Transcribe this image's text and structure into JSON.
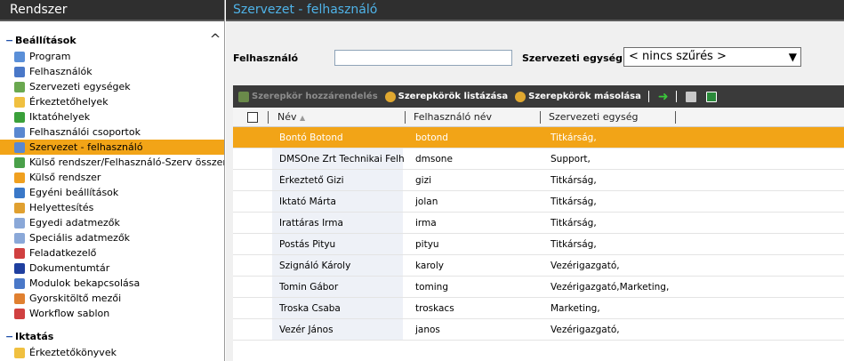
{
  "left_panel": {
    "title": "Rendszer",
    "sections": [
      {
        "label": "Beállítások",
        "items": [
          {
            "label": "Program",
            "icon": "gears-icon",
            "color": "#5a8fd8"
          },
          {
            "label": "Felhasználók",
            "icon": "user-icon",
            "color": "#4a78c8"
          },
          {
            "label": "Szervezeti egységek",
            "icon": "org-units-icon",
            "color": "#6aa84f"
          },
          {
            "label": "Érkeztetőhelyek",
            "icon": "inbox-icon",
            "color": "#f0c040"
          },
          {
            "label": "Iktatóhelyek",
            "icon": "check-box-icon",
            "color": "#3aa03a"
          },
          {
            "label": "Felhasználói csoportok",
            "icon": "user-group-icon",
            "color": "#5a88d0"
          },
          {
            "label": "Szervezet - felhasználó",
            "icon": "org-user-icon",
            "color": "#5a88d0"
          },
          {
            "label": "Külső rendszer/Felhasználó-Szerv összere",
            "icon": "globe-icon",
            "color": "#4aa04a"
          },
          {
            "label": "Külső rendszer",
            "icon": "ring-icon",
            "color": "#f0a020"
          },
          {
            "label": "Egyéni beállítások",
            "icon": "settings-icon",
            "color": "#3a78c8"
          },
          {
            "label": "Helyettesítés",
            "icon": "substitute-icon",
            "color": "#e0a030"
          },
          {
            "label": "Egyedi adatmezők",
            "icon": "grid-icon",
            "color": "#8aa8d8"
          },
          {
            "label": "Speciális adatmezők",
            "icon": "grid-icon",
            "color": "#8aa8d8"
          },
          {
            "label": "Feladatkezelő",
            "icon": "task-icon",
            "color": "#d04040"
          },
          {
            "label": "Dokumentumtár",
            "icon": "word-icon",
            "color": "#1f3f9f"
          },
          {
            "label": "Modulok bekapcsolása",
            "icon": "modules-icon",
            "color": "#4a78c8"
          },
          {
            "label": "Gyorskitöltő mezői",
            "icon": "quickfill-icon",
            "color": "#e08030"
          },
          {
            "label": "Workflow sablon",
            "icon": "workflow-icon",
            "color": "#d04040"
          }
        ]
      },
      {
        "label": "Iktatás",
        "items": [
          {
            "label": "Érkeztetőkönyvek",
            "icon": "inbox-icon",
            "color": "#f0c040"
          }
        ]
      }
    ]
  },
  "right_panel": {
    "title": "Szervezet - felhasználó",
    "filter": {
      "user_label": "Felhasználó",
      "user_value": "",
      "org_label": "Szervezeti egység",
      "org_selected": "< nincs szűrés >"
    },
    "toolbar": {
      "assign_role": "Szerepkör hozzárendelés",
      "list_roles": "Szerepkörök listázása",
      "copy_roles": "Szerepkörök másolása"
    },
    "grid": {
      "columns": [
        "Név",
        "Felhasználó név",
        "Szervezeti egység"
      ],
      "rows": [
        {
          "name": "Bontó Botond",
          "username": "botond",
          "org": "Titkárság,"
        },
        {
          "name": "DMSOne Zrt Technikai Felh...",
          "username": "dmsone",
          "org": "Support,"
        },
        {
          "name": "Érkeztető Gizi",
          "username": "gizi",
          "org": "Titkárság,"
        },
        {
          "name": "Iktató Márta",
          "username": "jolan",
          "org": "Titkárság,"
        },
        {
          "name": "Irattáras Irma",
          "username": "irma",
          "org": "Titkárság,"
        },
        {
          "name": "Postás Pityu",
          "username": "pityu",
          "org": "Titkárság,"
        },
        {
          "name": "Szignáló Károly",
          "username": "karoly",
          "org": "Vezérigazgató,"
        },
        {
          "name": "Tomin Gábor",
          "username": "toming",
          "org": "Vezérigazgató,Marketing,"
        },
        {
          "name": "Troska Csaba",
          "username": "troskacs",
          "org": "Marketing,"
        },
        {
          "name": "Vezér János",
          "username": "janos",
          "org": "Vezérigazgató,"
        }
      ]
    }
  },
  "colors": {
    "header_bg": "#2f2f2f",
    "title_blue": "#4fb3e8",
    "selection": "#f2a417"
  }
}
